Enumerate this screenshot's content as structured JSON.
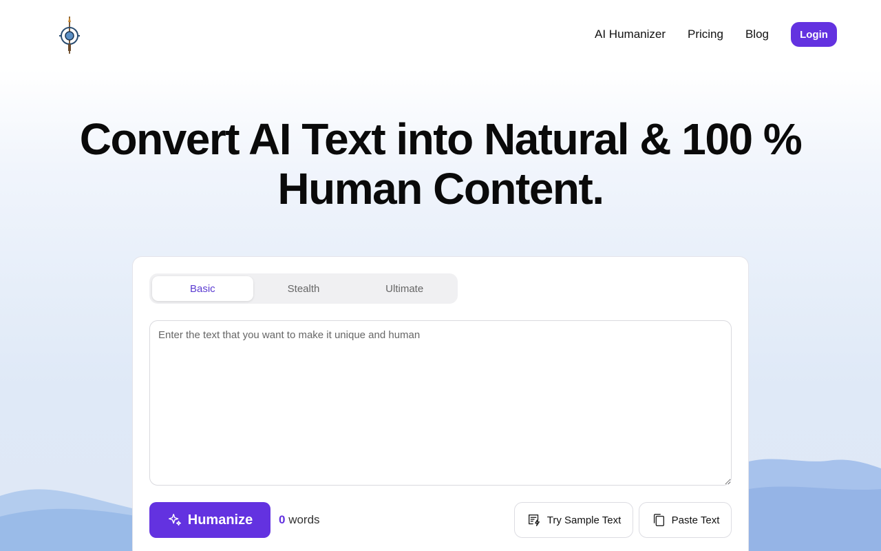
{
  "header": {
    "logo_icon": "pen-compass-logo",
    "nav": [
      {
        "label": "AI Humanizer"
      },
      {
        "label": "Pricing"
      },
      {
        "label": "Blog"
      }
    ],
    "login_label": "Login"
  },
  "hero": {
    "title_line1": "Convert AI Text into Natural & 100 %",
    "title_line2": "Human Content."
  },
  "editor": {
    "tabs": [
      {
        "label": "Basic",
        "active": true
      },
      {
        "label": "Stealth",
        "active": false
      },
      {
        "label": "Ultimate",
        "active": false
      }
    ],
    "textarea": {
      "value": "",
      "placeholder": "Enter the text that you want to make it unique and human"
    },
    "humanize_label": "Humanize",
    "word_count": "0",
    "word_label": "words",
    "sample_label": "Try Sample Text",
    "paste_label": "Paste Text"
  },
  "colors": {
    "accent": "#6332e0",
    "active_tab_text": "#5b3bd1"
  }
}
